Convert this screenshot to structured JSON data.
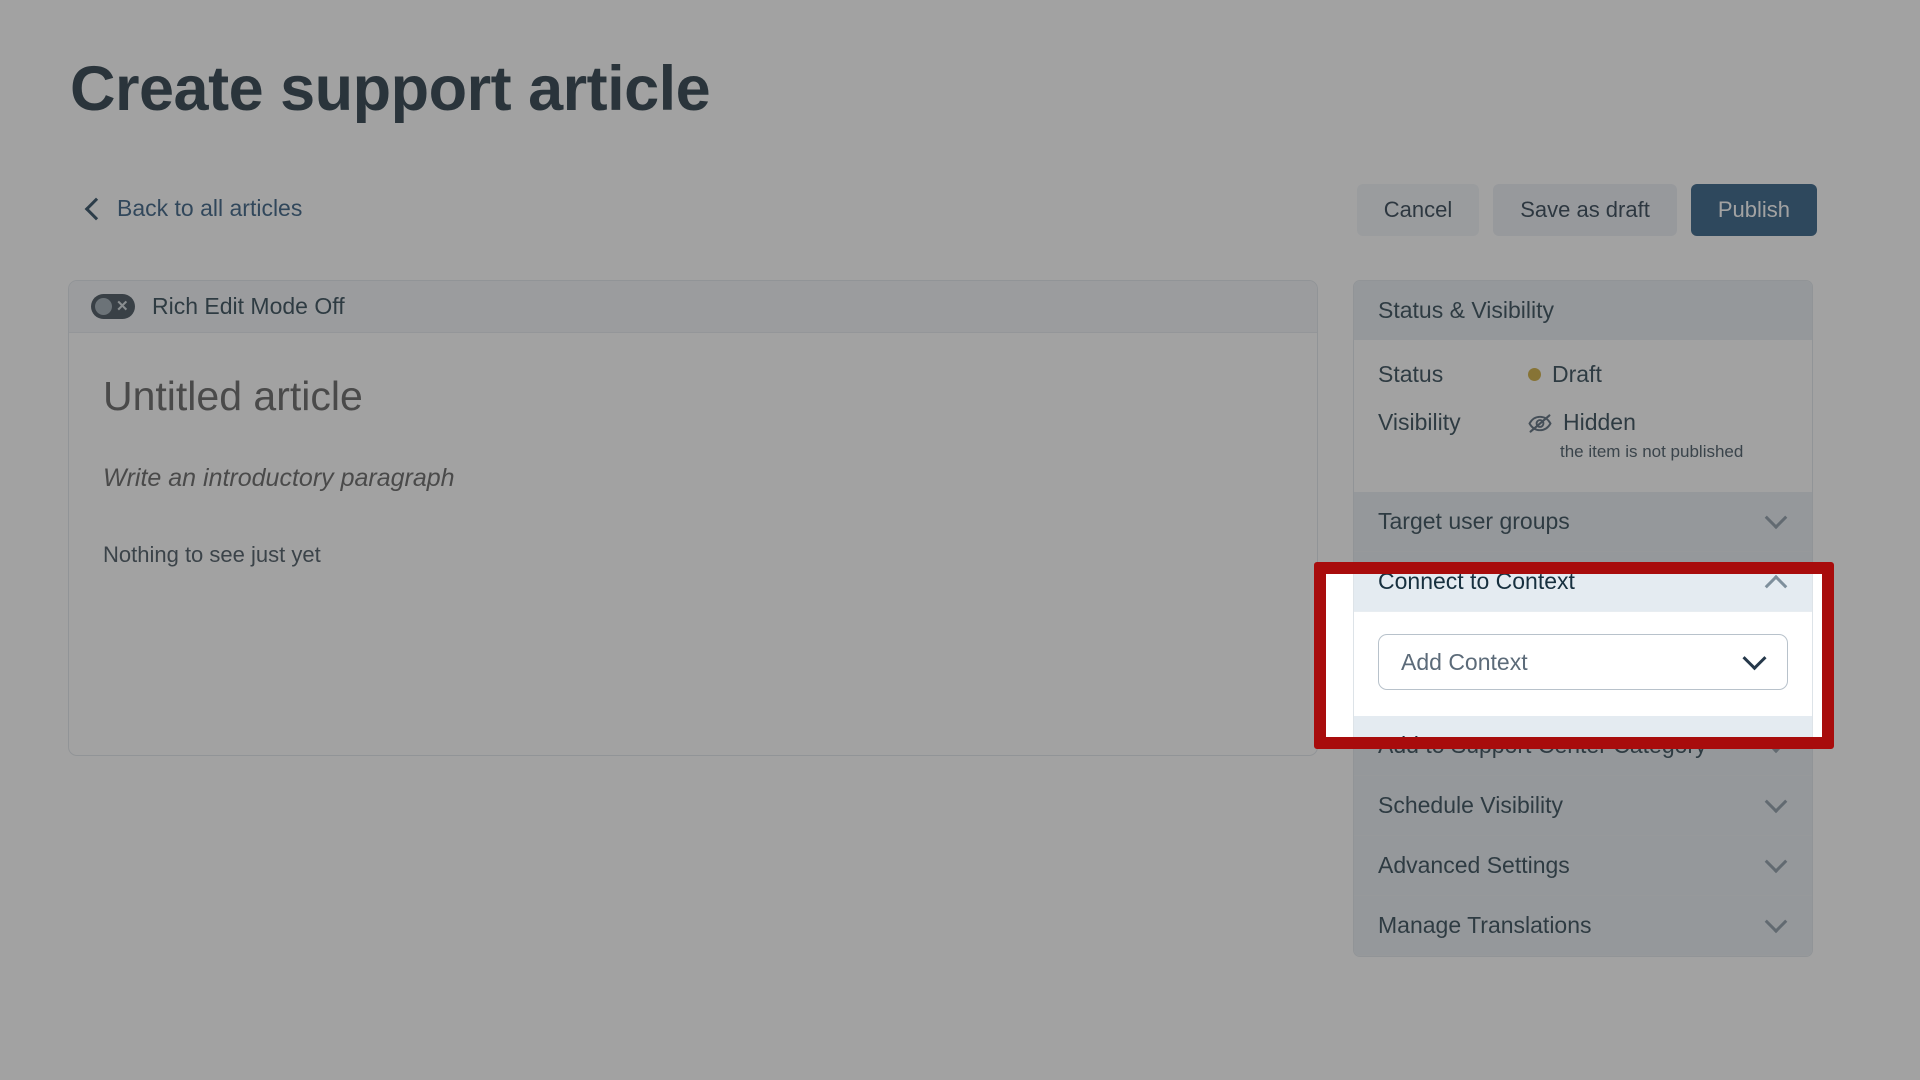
{
  "header": {
    "title": "Create support article",
    "back_link": "Back to all articles",
    "back_icon": "chevron-left-icon"
  },
  "actions": {
    "cancel": "Cancel",
    "save_draft": "Save as draft",
    "publish": "Publish",
    "publish_color": "#164a75"
  },
  "editor": {
    "toolbar": {
      "toggle_icon": "toggle-off-icon",
      "toggle_label": "Rich Edit Mode Off"
    },
    "doc_title": "Untitled article",
    "doc_intro": "Write an introductory paragraph",
    "doc_body": "Nothing to see just yet"
  },
  "sidebar": {
    "status_section": {
      "title": "Status & Visibility",
      "rows": [
        {
          "key": "Status",
          "value": "Draft",
          "icon": "status-dot-icon",
          "icon_color": "#c9a227",
          "note": ""
        },
        {
          "key": "Visibility",
          "value": "Hidden",
          "icon": "eye-off-icon",
          "icon_color": "#45586a",
          "note": "the item is not published"
        }
      ]
    },
    "sections": [
      {
        "label": "Target user groups",
        "chevron": "chevron-down-icon",
        "expanded": false
      },
      {
        "label": "Connect to Context",
        "chevron": "chevron-up-icon",
        "expanded": true
      },
      {
        "label": "Add to Support Center Category",
        "chevron": "chevron-down-icon",
        "expanded": false
      },
      {
        "label": "Schedule Visibility",
        "chevron": "chevron-down-icon",
        "expanded": false
      },
      {
        "label": "Advanced Settings",
        "chevron": "chevron-down-icon",
        "expanded": false
      },
      {
        "label": "Manage Translations",
        "chevron": "chevron-down-icon",
        "expanded": false
      }
    ],
    "context_dropdown": {
      "value": "Add Context",
      "chevron": "chevron-down-icon"
    }
  },
  "annotation": {
    "type": "highlight-box",
    "color": "#a80c0c"
  }
}
